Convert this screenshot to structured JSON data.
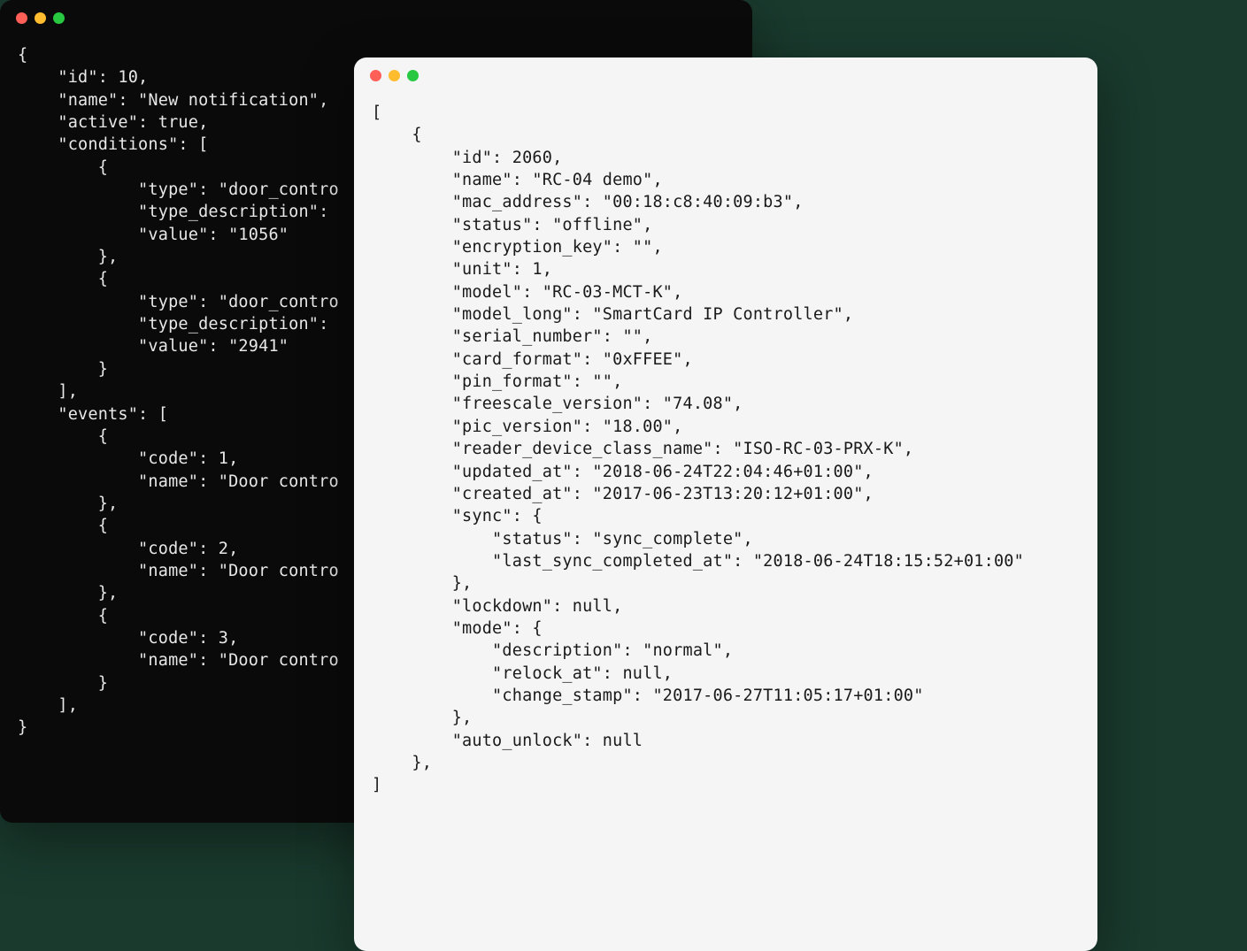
{
  "dark_window": {
    "code": "{\n    \"id\": 10,\n    \"name\": \"New notification\",\n    \"active\": true,\n    \"conditions\": [\n        {\n            \"type\": \"door_contro\n            \"type_description\":\n            \"value\": \"1056\"\n        },\n        {\n            \"type\": \"door_contro\n            \"type_description\":\n            \"value\": \"2941\"\n        }\n    ],\n    \"events\": [\n        {\n            \"code\": 1,\n            \"name\": \"Door contro\n        },\n        {\n            \"code\": 2,\n            \"name\": \"Door contro\n        },\n        {\n            \"code\": 3,\n            \"name\": \"Door contro\n        }\n    ],\n}"
  },
  "light_window": {
    "code": "[\n    {\n        \"id\": 2060,\n        \"name\": \"RC-04 demo\",\n        \"mac_address\": \"00:18:c8:40:09:b3\",\n        \"status\": \"offline\",\n        \"encryption_key\": \"\",\n        \"unit\": 1,\n        \"model\": \"RC-03-MCT-K\",\n        \"model_long\": \"SmartCard IP Controller\",\n        \"serial_number\": \"\",\n        \"card_format\": \"0xFFEE\",\n        \"pin_format\": \"\",\n        \"freescale_version\": \"74.08\",\n        \"pic_version\": \"18.00\",\n        \"reader_device_class_name\": \"ISO-RC-03-PRX-K\",\n        \"updated_at\": \"2018-06-24T22:04:46+01:00\",\n        \"created_at\": \"2017-06-23T13:20:12+01:00\",\n        \"sync\": {\n            \"status\": \"sync_complete\",\n            \"last_sync_completed_at\": \"2018-06-24T18:15:52+01:00\"\n        },\n        \"lockdown\": null,\n        \"mode\": {\n            \"description\": \"normal\",\n            \"relock_at\": null,\n            \"change_stamp\": \"2017-06-27T11:05:17+01:00\"\n        },\n        \"auto_unlock\": null\n    },\n]"
  }
}
